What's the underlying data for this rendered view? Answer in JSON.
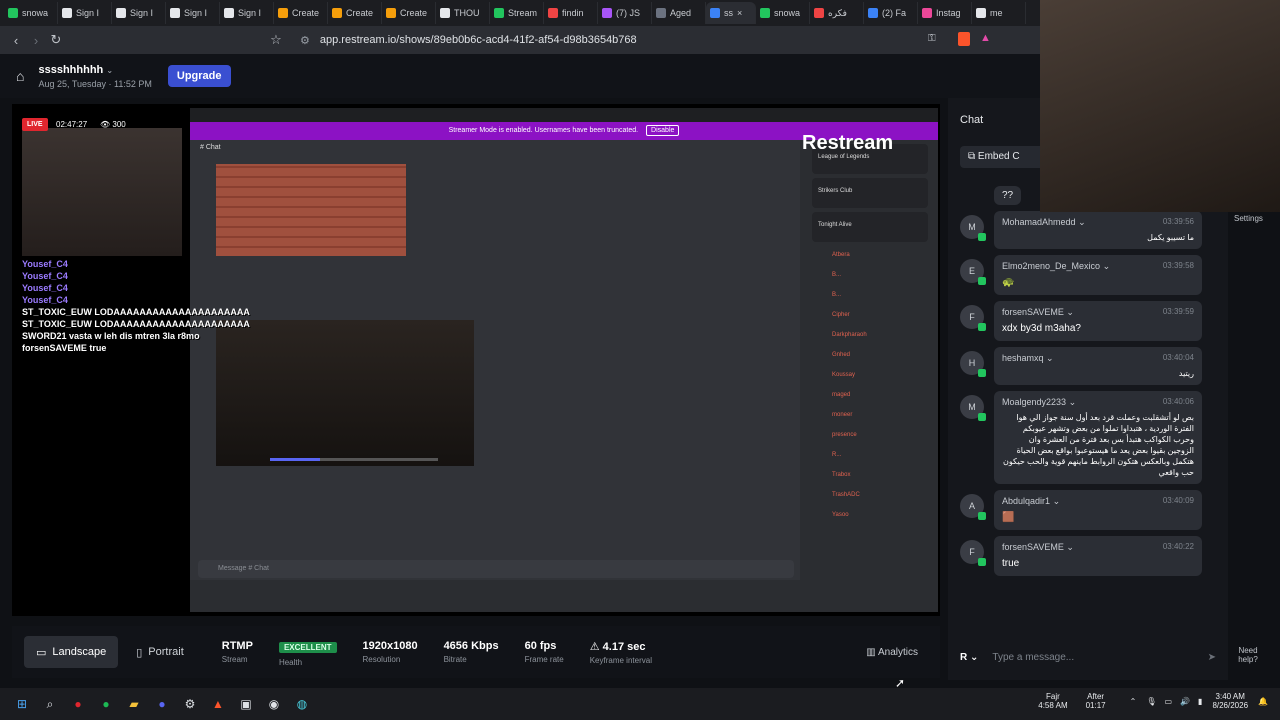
{
  "browser": {
    "tabs": [
      {
        "label": "snowa",
        "color": "#22c55e"
      },
      {
        "label": "Sign I",
        "color": "#e5e7eb"
      },
      {
        "label": "Sign I",
        "color": "#e5e7eb"
      },
      {
        "label": "Sign I",
        "color": "#e5e7eb"
      },
      {
        "label": "Sign I",
        "color": "#e5e7eb"
      },
      {
        "label": "Create",
        "color": "#f59e0b"
      },
      {
        "label": "Create",
        "color": "#f59e0b"
      },
      {
        "label": "Create",
        "color": "#f59e0b"
      },
      {
        "label": "THOU",
        "color": "#e5e7eb"
      },
      {
        "label": "Stream",
        "color": "#22c55e"
      },
      {
        "label": "findin",
        "color": "#ef4444"
      },
      {
        "label": "(7) JS",
        "color": "#a855f7"
      },
      {
        "label": "Aged",
        "color": "#6b7280"
      },
      {
        "label": "ss",
        "color": "#3b82f6",
        "active": true
      },
      {
        "label": "snowa",
        "color": "#22c55e"
      },
      {
        "label": "فكره",
        "color": "#ef4444"
      },
      {
        "label": "(2) Fa",
        "color": "#3b82f6"
      },
      {
        "label": "Instag",
        "color": "#ec4899"
      },
      {
        "label": "me",
        "color": "#e5e7eb"
      }
    ],
    "url": "app.restream.io/shows/89eb0b6c-acd4-41f2-af54-d98b3654b768"
  },
  "show": {
    "name": "sssshhhhhh",
    "date": "Aug 25, Tuesday · 11:52 PM",
    "upgrade_label": "Upgrade"
  },
  "preview": {
    "live_label": "LIVE",
    "live_time": "02:47:27",
    "viewers": "300",
    "streamer_mode": "Streamer Mode is enabled. Usernames have been truncated.",
    "disable_label": "Disable",
    "restream_logo": "Restream",
    "channel": "Chat",
    "overlay_lines": [
      "Yousef_C4",
      "Yousef_C4",
      "Yousef_C4",
      "Yousef_C4",
      "ST_TOXIC_EUW LODAAAAAAAAAAAAAAAAAAAAA",
      "ST_TOXIC_EUW LODAAAAAAAAAAAAAAAAAAAAA",
      "SWORD21 vasta w leh dis mtren 3la r8mo",
      "forsenSAVEME true"
    ],
    "members": [
      "Atbera",
      "B...",
      "B...",
      "Cipher",
      "Darkpharaoh",
      "Gnhed",
      "Koussay",
      "maged",
      "moneer",
      "presence",
      "R...",
      "Trabox",
      "TrashADC",
      "Yasoo"
    ],
    "activity_items": [
      "League of Legends",
      "Strikers Club",
      "Tonight Alive"
    ],
    "message_input": "Message # Chat"
  },
  "stats": {
    "landscape_label": "Landscape",
    "portrait_label": "Portrait",
    "protocol": {
      "value": "RTMP",
      "label": "Stream"
    },
    "health": {
      "value": "EXCELLENT",
      "label": "Health"
    },
    "resolution": {
      "value": "1920x1080",
      "label": "Resolution"
    },
    "bitrate": {
      "value": "4656 Kbps",
      "label": "Bitrate"
    },
    "framerate": {
      "value": "60 fps",
      "label": "Frame rate"
    },
    "keyframe": {
      "value": "4.17 sec",
      "label": "Keyframe interval"
    },
    "analytics_label": "Analytics"
  },
  "chat": {
    "title": "Chat",
    "embed_label": "Embed C",
    "first_text": "??",
    "messages": [
      {
        "initial": "M",
        "name": "MohamadAhmedd",
        "time": "03:39:56",
        "text": "ما تسيبو يكمل",
        "rtl": true
      },
      {
        "initial": "E",
        "name": "Elmo2meno_De_Mexico",
        "time": "03:39:58",
        "text": "🐢",
        "rtl": false
      },
      {
        "initial": "F",
        "name": "forsenSAVEME",
        "time": "03:39:59",
        "text": "xdx by3d m3aha?",
        "rtl": false
      },
      {
        "initial": "H",
        "name": "heshamxq",
        "time": "03:40:04",
        "text": "ريتيد",
        "rtl": true
      },
      {
        "initial": "M",
        "name": "Moalgendy2233",
        "time": "03:40:06",
        "text": "بص لو أتشقلبت وعملت قرد بعد أول سنة جواز الي هوا الفترة الوردية ، هتبداوا تملوا من بعض وتشهر عيوبكم وحرب الكواكب هتبدأ بس بعد فترة من العشرة وان الزوجين بقيوا بعض يعد ما هيستوعبوا بواقع بعض الحياة هتكمل وبالعكس هتكون الروابط ماينهم قوية والحب حيكون حب واقعي",
        "rtl": true
      },
      {
        "initial": "A",
        "name": "Abdulqadir1",
        "time": "03:40:09",
        "text": "🟫",
        "rtl": false
      },
      {
        "initial": "F",
        "name": "forsenSAVEME",
        "time": "03:40:22",
        "text": "true",
        "rtl": false
      }
    ],
    "input_placeholder": "Type a message...",
    "input_badge": "R"
  },
  "overlay": {
    "settings_label": "Settings",
    "need_help_label": "Need help?"
  },
  "taskbar": {
    "prayer_name": "Fajr",
    "prayer_time": "4:58 AM",
    "after_label": "After",
    "after_value": "01:17",
    "clock_time": "3:40 AM",
    "clock_date": "8/26/2026"
  }
}
